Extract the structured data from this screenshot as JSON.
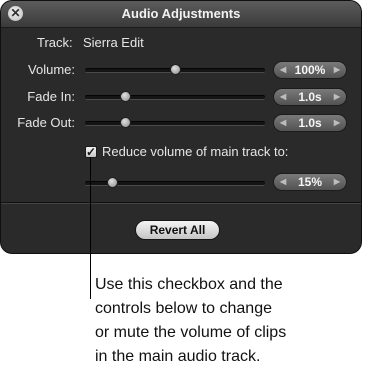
{
  "panel": {
    "title": "Audio Adjustments",
    "close_glyph": "✕",
    "track_label": "Track:",
    "track_value": "Sierra Edit",
    "volume": {
      "label": "Volume:",
      "value": "100%",
      "level": 0.5
    },
    "fade_in": {
      "label": "Fade In:",
      "value": "1.0s",
      "level": 0.22
    },
    "fade_out": {
      "label": "Fade Out:",
      "value": "1.0s",
      "level": 0.22
    },
    "reduce": {
      "checked": true,
      "check_glyph": "✓",
      "label": "Reduce volume of main track to:",
      "value": "15%",
      "level": 0.15
    },
    "stepper_left_glyph": "◀",
    "stepper_right_glyph": "▶",
    "revert_label": "Revert All"
  },
  "callout": {
    "text": "Use this checkbox and the\ncontrols below to change\nor mute the volume of clips\nin the main audio track."
  },
  "colors": {
    "panel_bg": "#2a2a2a",
    "titlebar": "#4a4a4a",
    "label_text": "#e6e6e6"
  }
}
